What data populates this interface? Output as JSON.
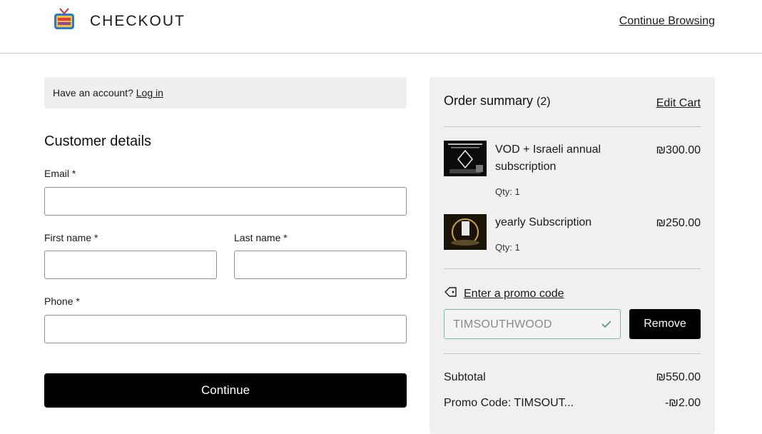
{
  "header": {
    "title": "CHECKOUT",
    "continue_browsing": "Continue Browsing",
    "logo_icon": "tv-logo-icon"
  },
  "account": {
    "prompt": "Have an account?",
    "login_link": "Log in"
  },
  "customer": {
    "section_title": "Customer details",
    "email_label": "Email *",
    "email_value": "",
    "first_name_label": "First name *",
    "first_name_value": "",
    "last_name_label": "Last name *",
    "last_name_value": "",
    "phone_label": "Phone *",
    "phone_value": "",
    "continue_label": "Continue"
  },
  "summary": {
    "title": "Order summary",
    "count": "(2)",
    "edit_cart": "Edit Cart",
    "items": [
      {
        "name": "VOD + Israeli annual subscription",
        "qty": "Qty: 1",
        "price": "₪300.00"
      },
      {
        "name": "yearly Subscription",
        "qty": "Qty: 1",
        "price": "₪250.00"
      }
    ],
    "promo_link": "Enter a promo code",
    "promo_value": "TIMSOUTHWOOD",
    "remove_label": "Remove",
    "subtotal_label": "Subtotal",
    "subtotal_value": "₪550.00",
    "promo_code_label": "Promo Code: TIMSOUT...",
    "promo_code_value": "-₪2.00"
  },
  "colors": {
    "accent_black": "#000000",
    "panel_gray": "#f0f0f0",
    "promo_border_green": "#7fb89a"
  }
}
